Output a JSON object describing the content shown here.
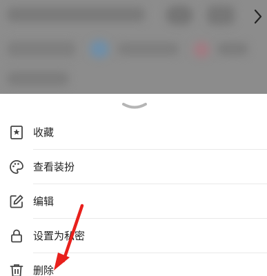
{
  "sheet": {
    "items": [
      {
        "label": "收藏",
        "icon": "bookmark-star-icon"
      },
      {
        "label": "查看装扮",
        "icon": "palette-icon"
      },
      {
        "label": "编辑",
        "icon": "edit-icon"
      },
      {
        "label": "设置为私密",
        "icon": "lock-icon"
      },
      {
        "label": "删除",
        "icon": "trash-icon"
      }
    ]
  },
  "colors": {
    "annotation_arrow": "#e8201c",
    "overlay": "#8c8c8c",
    "icon": "#444444",
    "text": "#222222"
  }
}
